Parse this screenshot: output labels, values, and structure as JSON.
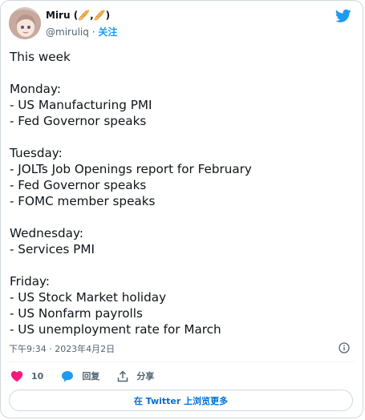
{
  "author": {
    "display_name": "Miru (🥖,🥖)",
    "handle": "@miruliq",
    "separator": "·",
    "follow_label": "关注"
  },
  "tweet": {
    "lines": [
      "This week",
      "",
      "Monday:",
      "- US Manufacturing PMI",
      "- Fed Governor speaks",
      "",
      "Tuesday:",
      "- JOLTs Job Openings report for February",
      "- Fed Governor speaks",
      "- FOMC member speaks",
      "",
      "Wednesday:",
      "- Services PMI",
      "",
      "Friday:",
      "- US Stock Market holiday",
      "- US Nonfarm payrolls",
      "- US unemployment rate for March"
    ],
    "timestamp": "下午9:34 · 2023年4月2日"
  },
  "actions": {
    "like_count": "10",
    "reply_label": "回复",
    "share_label": "分享"
  },
  "read_more_label": "在 Twitter 上浏览更多",
  "colors": {
    "accent": "#1d9bf0",
    "like": "#f91880",
    "link": "#006fd6",
    "muted": "#536471"
  },
  "icons": [
    "twitter-bird-icon",
    "info-icon",
    "heart-icon",
    "reply-bubble-icon",
    "share-icon"
  ]
}
